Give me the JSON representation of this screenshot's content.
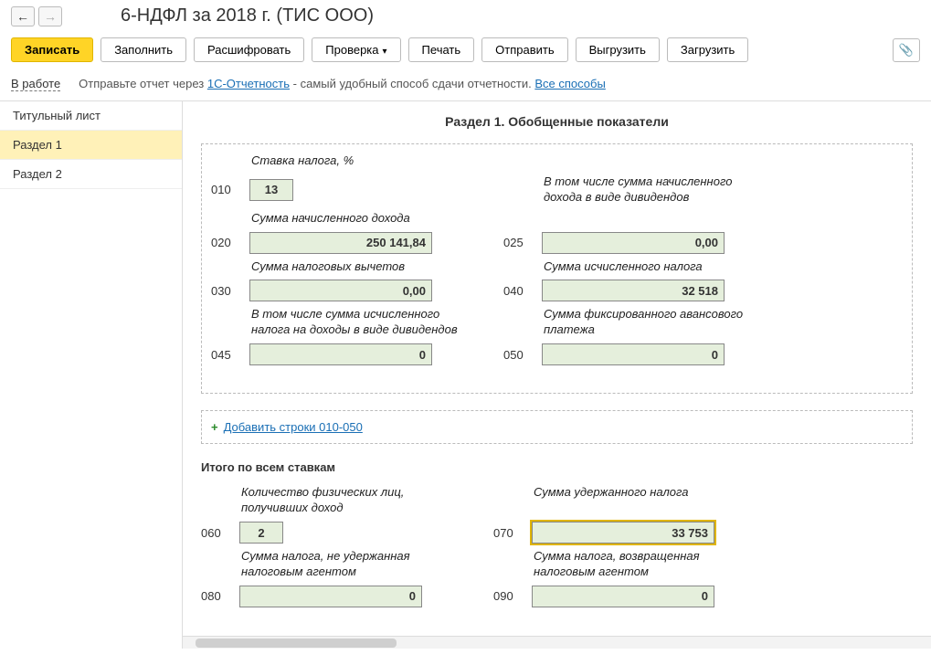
{
  "header": {
    "title": "6-НДФЛ за 2018 г. (ТИС ООО)"
  },
  "toolbar": {
    "save": "Записать",
    "fill": "Заполнить",
    "decrypt": "Расшифровать",
    "check": "Проверка",
    "print": "Печать",
    "send": "Отправить",
    "export": "Выгрузить",
    "import": "Загрузить"
  },
  "status": {
    "state": "В работе",
    "hint_pre": "Отправьте отчет через ",
    "hint_link": "1С-Отчетность",
    "hint_post": " - самый удобный способ сдачи отчетности. ",
    "all_ways": "Все способы"
  },
  "sidebar": {
    "items": [
      "Титульный лист",
      "Раздел 1",
      "Раздел 2"
    ],
    "active": 1
  },
  "section": {
    "title": "Раздел 1. Обобщенные показатели",
    "rate_label": "Ставка налога, %",
    "rows": {
      "r010": {
        "code": "010",
        "value": "13"
      },
      "r020": {
        "code": "020",
        "label": "Сумма начисленного дохода",
        "value": "250 141,84"
      },
      "r025": {
        "code": "025",
        "label": "В том числе сумма начисленного дохода в виде дивидендов",
        "value": "0,00"
      },
      "r030": {
        "code": "030",
        "label": "Сумма налоговых вычетов",
        "value": "0,00"
      },
      "r040": {
        "code": "040",
        "label": "Сумма исчисленного налога",
        "value": "32 518"
      },
      "r045": {
        "code": "045",
        "label": "В том числе сумма исчисленного налога на доходы в виде дивидендов",
        "value": "0"
      },
      "r050": {
        "code": "050",
        "label": "Сумма фиксированного авансового платежа",
        "value": "0"
      }
    },
    "add_link": "Добавить строки 010-050",
    "totals_title": "Итого по всем ставкам",
    "totals": {
      "r060": {
        "code": "060",
        "label": "Количество физических лиц, получивших доход",
        "value": "2"
      },
      "r070": {
        "code": "070",
        "label": "Сумма удержанного налога",
        "value": "33 753"
      },
      "r080": {
        "code": "080",
        "label": "Сумма налога, не удержанная налоговым агентом",
        "value": "0"
      },
      "r090": {
        "code": "090",
        "label": "Сумма налога, возвращенная налоговым агентом",
        "value": "0"
      }
    }
  }
}
